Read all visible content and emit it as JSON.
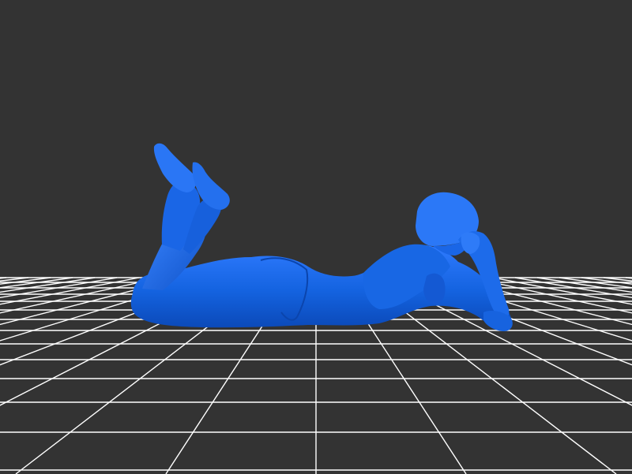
{
  "viewport": {
    "background_color": "#333333",
    "grid_color": "#ffffff",
    "model_color": "#1463e0",
    "model_shadow_color": "#0a3fa8",
    "model_highlight_color": "#3d86ff"
  }
}
